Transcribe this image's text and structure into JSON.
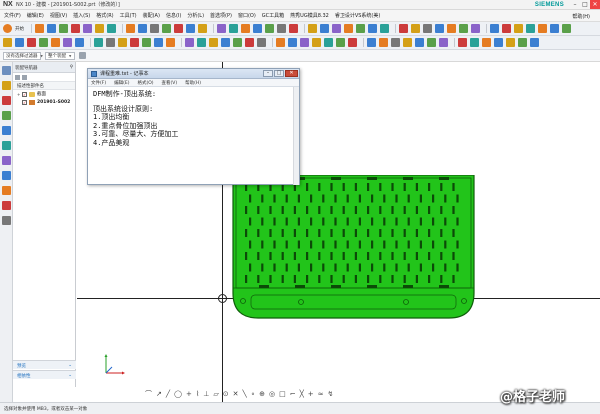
{
  "window": {
    "logo": "NX",
    "title": "NX 10 - 建模 - [201901-S002.prt（修改的）]",
    "brand": "SIEMENS",
    "controls": {
      "minimize": "–",
      "maximize": "□",
      "close": "✕"
    }
  },
  "menubar": {
    "items": [
      "文件(F)",
      "编辑(E)",
      "视图(V)",
      "插入(S)",
      "格式(R)",
      "工具(T)",
      "装配(A)",
      "信息(I)",
      "分析(L)",
      "首选项(P)",
      "窗口(O)",
      "GC工具箱",
      "燕秀UG模具8.32",
      "睿卫设计VS系统(美)"
    ],
    "help": "帮助(H)"
  },
  "toolbar1": {
    "start_label": "开始",
    "icon_colors": [
      "#e57c22",
      "#3b7fd1",
      "#5aa04a",
      "#cc3b3b",
      "#8a63c9",
      "#d4a017",
      "#2aa198",
      "#e57c22",
      "#3b7fd1",
      "#777777",
      "#5aa04a",
      "#cc3b3b",
      "#3b7fd1",
      "#d4a017",
      "#8a63c9",
      "#2aa198",
      "#e57c22",
      "#3b7fd1",
      "#5aa04a",
      "#777777",
      "#cc3b3b",
      "#d4a017",
      "#3b7fd1",
      "#8a63c9",
      "#e57c22",
      "#5aa04a",
      "#3b7fd1",
      "#2aa198",
      "#cc3b3b",
      "#d4a017",
      "#777777",
      "#3b7fd1",
      "#e57c22",
      "#5aa04a",
      "#8a63c9",
      "#3b7fd1",
      "#cc3b3b",
      "#d4a017",
      "#2aa198",
      "#e57c22",
      "#3b7fd1",
      "#5aa04a"
    ]
  },
  "toolbar2": {
    "icon_colors": [
      "#d4a017",
      "#3b7fd1",
      "#cc3b3b",
      "#5aa04a",
      "#e57c22",
      "#8a63c9",
      "#3b7fd1",
      "#2aa198",
      "#777777",
      "#d4a017",
      "#cc3b3b",
      "#5aa04a",
      "#3b7fd1",
      "#e57c22",
      "#8a63c9",
      "#2aa198",
      "#d4a017",
      "#3b7fd1",
      "#5aa04a",
      "#cc3b3b",
      "#777777",
      "#e57c22",
      "#3b7fd1",
      "#8a63c9",
      "#d4a017",
      "#2aa198",
      "#5aa04a",
      "#cc3b3b",
      "#3b7fd1",
      "#e57c22",
      "#777777",
      "#d4a017",
      "#3b7fd1",
      "#5aa04a",
      "#8a63c9",
      "#cc3b3b",
      "#2aa198",
      "#e57c22",
      "#3b7fd1",
      "#d4a017",
      "#5aa04a",
      "#3b7fd1"
    ]
  },
  "selection_bar": {
    "filter_label": "没有选择过滤器",
    "scope_label": "整个装配"
  },
  "navigator": {
    "header": "装配导航器",
    "column_header": "描述性部件名",
    "tree": [
      {
        "label": "截面",
        "type": "folder"
      },
      {
        "label": "201901-S002",
        "type": "part"
      }
    ],
    "sections": {
      "preview": "预览",
      "relations": "相依性"
    }
  },
  "notepad": {
    "title": "课程重难.txt - 记事本",
    "menu": [
      "文件(F)",
      "编辑(E)",
      "格式(O)",
      "查看(V)",
      "帮助(H)"
    ],
    "lines": [
      "DFM制作-顶出系统:",
      "",
      "顶出系统设计原则:",
      "1.顶出均衡",
      "2.重点骨位加强顶出",
      "3.可靠、尽量大、方便加工",
      "4.产品美观"
    ]
  },
  "snap_toolbar": {
    "glyphs": [
      "⌒",
      "↗",
      "╱",
      "◯",
      "+",
      "⌇",
      "⊥",
      "▱",
      "⊙",
      "✕",
      "╲",
      "∘",
      "⊕",
      "◎",
      "□",
      "⌐",
      "╳",
      "+",
      "≈",
      "↯"
    ]
  },
  "status": {
    "text": "选择对象并使用 MB3，或者双击某一对象"
  },
  "watermark": "@格子老师",
  "colors": {
    "part_green": "#22c41a",
    "part_edge": "#0f5e0a",
    "slot_dark": "#0c4a08"
  }
}
